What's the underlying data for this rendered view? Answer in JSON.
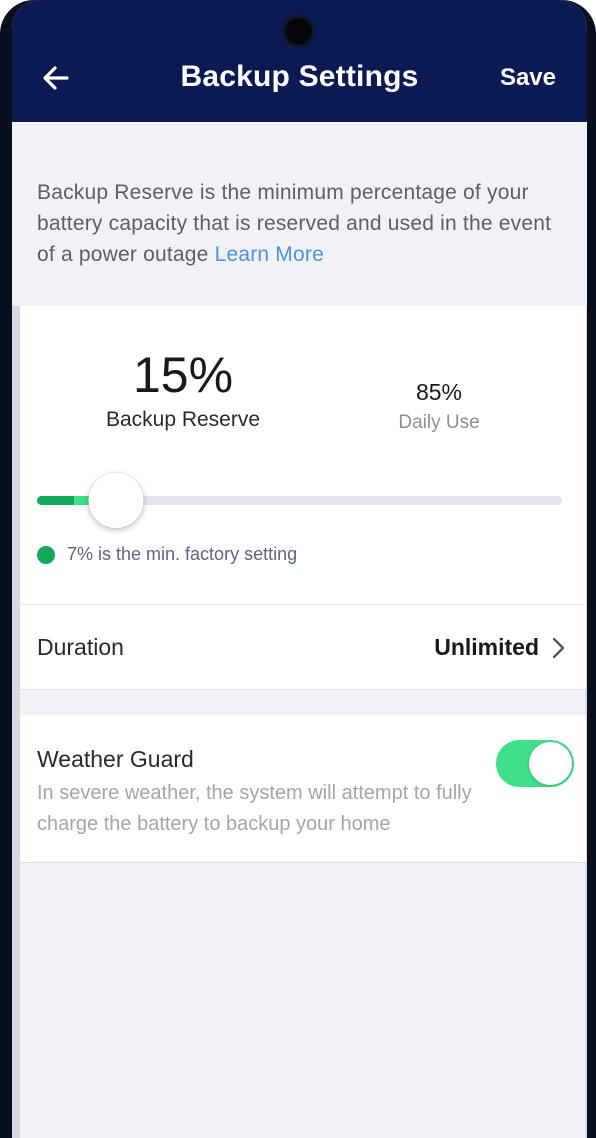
{
  "header": {
    "title": "Backup Settings",
    "save_label": "Save",
    "back_icon": "arrow-left-icon",
    "background": "#0b1a52"
  },
  "info": {
    "text": "Backup Reserve is the minimum percentage of your battery capacity that is reserved and used in the event of a power outage ",
    "link_text": "Learn More"
  },
  "reserve": {
    "value_text": "15%",
    "label": "Backup Reserve",
    "daily_value_text": "85%",
    "daily_label": "Daily Use",
    "slider_percent": 15,
    "min_percent": 7,
    "factory_note": "7% is the min. factory setting"
  },
  "duration": {
    "label": "Duration",
    "value": "Unlimited"
  },
  "weather_guard": {
    "title": "Weather Guard",
    "description": "In severe weather, the system will attempt to fully charge the battery to backup your home",
    "enabled": true
  },
  "colors": {
    "accent_green": "#3fe089",
    "min_green": "#13a85a",
    "link_blue": "#4f90e6"
  }
}
